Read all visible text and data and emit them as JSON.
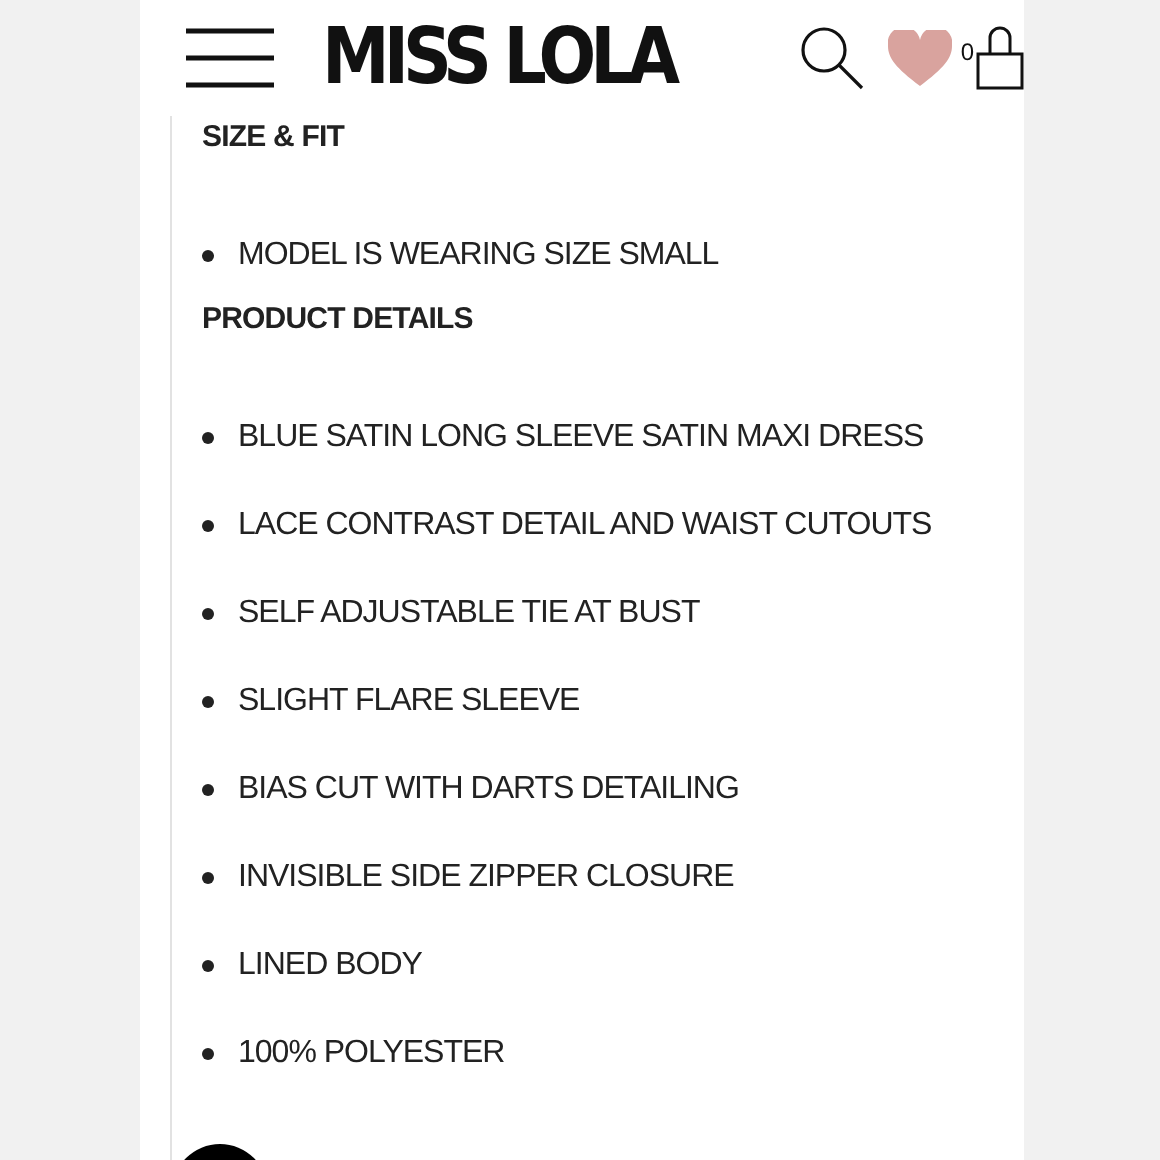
{
  "header": {
    "logo": "MISS LOLA",
    "cart_count": "0"
  },
  "sections": [
    {
      "heading": "SIZE & FIT",
      "items": [
        "MODEL IS WEARING SIZE SMALL"
      ]
    },
    {
      "heading": "PRODUCT DETAILS",
      "items": [
        "BLUE SATIN LONG SLEEVE SATIN MAXI DRESS",
        "LACE CONTRAST DETAIL AND WAIST CUTOUTS",
        "SELF ADJUSTABLE TIE AT BUST",
        "SLIGHT FLARE SLEEVE",
        "BIAS CUT WITH DARTS DETAILING",
        "INVISIBLE SIDE ZIPPER CLOSURE",
        "LINED BODY",
        "100% POLYESTER"
      ]
    }
  ]
}
